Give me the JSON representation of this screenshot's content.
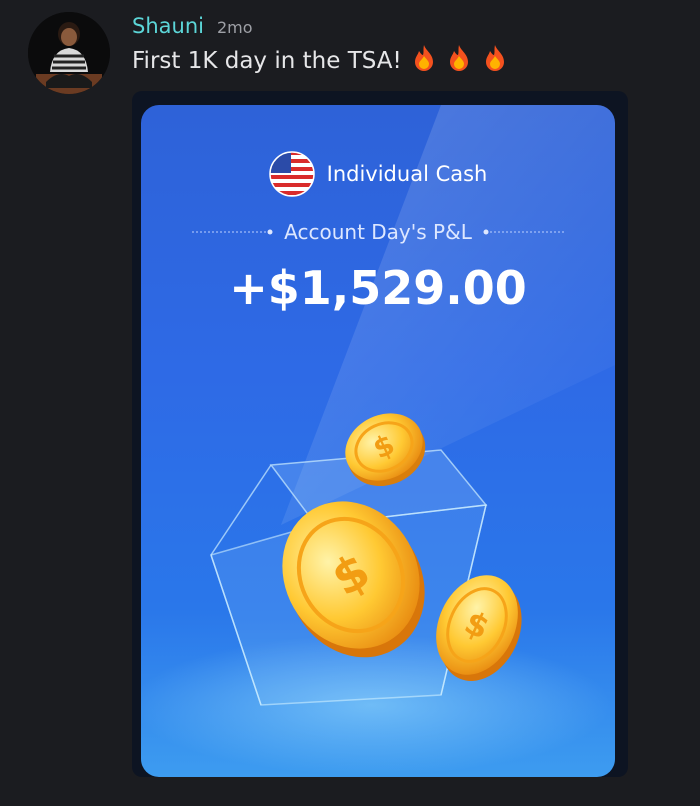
{
  "post": {
    "username": "Shauni",
    "timestamp": "2mo",
    "message": "First 1K day in the TSA!",
    "reactions": [
      "fire-emoji",
      "fire-emoji",
      "fire-emoji"
    ]
  },
  "card": {
    "account_name": "Individual Cash",
    "pl_label": "Account Day's P&L",
    "pl_value": "+$1,529.00",
    "flag_icon": "us-flag-icon",
    "accent_color": "#2e6ae6"
  }
}
